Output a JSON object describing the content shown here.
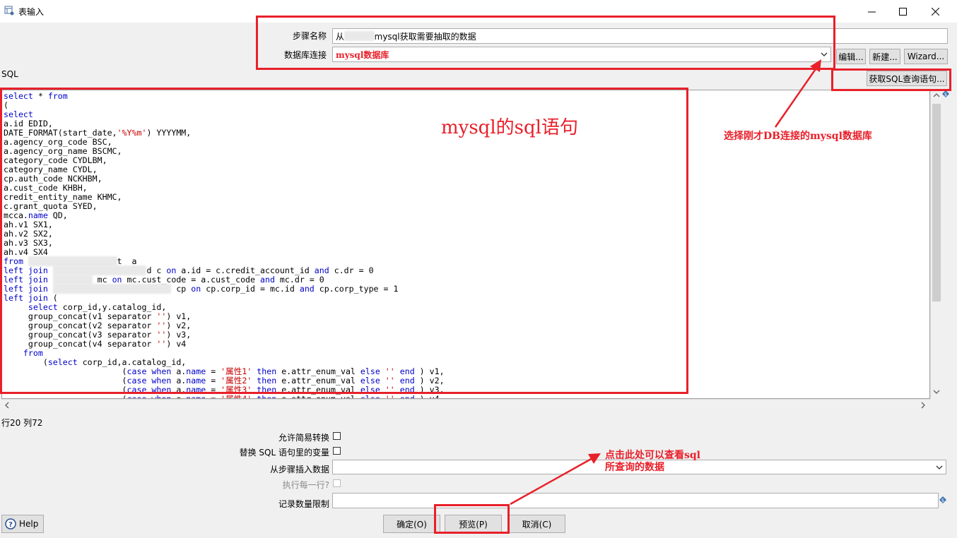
{
  "window": {
    "title": "表输入"
  },
  "form": {
    "step_name_label": "步骤名称",
    "step_name_value": "从",
    "step_name_value_suffix": "mysql获取需要抽取的数据",
    "db_conn_label": "数据库连接",
    "db_conn_value": "mysql数据库",
    "edit_btn": "编辑...",
    "new_btn": "新建...",
    "wizard_btn": "Wizard...",
    "get_sql_btn": "获取SQL查询语句..."
  },
  "sql": {
    "label": "SQL",
    "position": "行20 列72"
  },
  "options": {
    "lazy_conversion_label": "允许简易转换",
    "replace_vars_label": "替换 SQL 语句里的变量",
    "insert_from_step_label": "从步骤插入数据",
    "execute_each_row_label": "执行每一行?",
    "limit_label": "记录数量限制"
  },
  "buttons": {
    "help": "Help",
    "ok": "确定(O)",
    "preview": "预览(P)",
    "cancel": "取消(C)"
  },
  "annotations": {
    "sql_note": "mysql的sql语句",
    "db_note": "选择刚才DB连接的mysql数据库",
    "preview_note_line1": "点击此处可以查看sql",
    "preview_note_line2": "所查询的数据"
  },
  "colors": {
    "annotation_red": "#e8202a",
    "keyword_blue": "#0000c8",
    "string_red": "#c80000"
  }
}
